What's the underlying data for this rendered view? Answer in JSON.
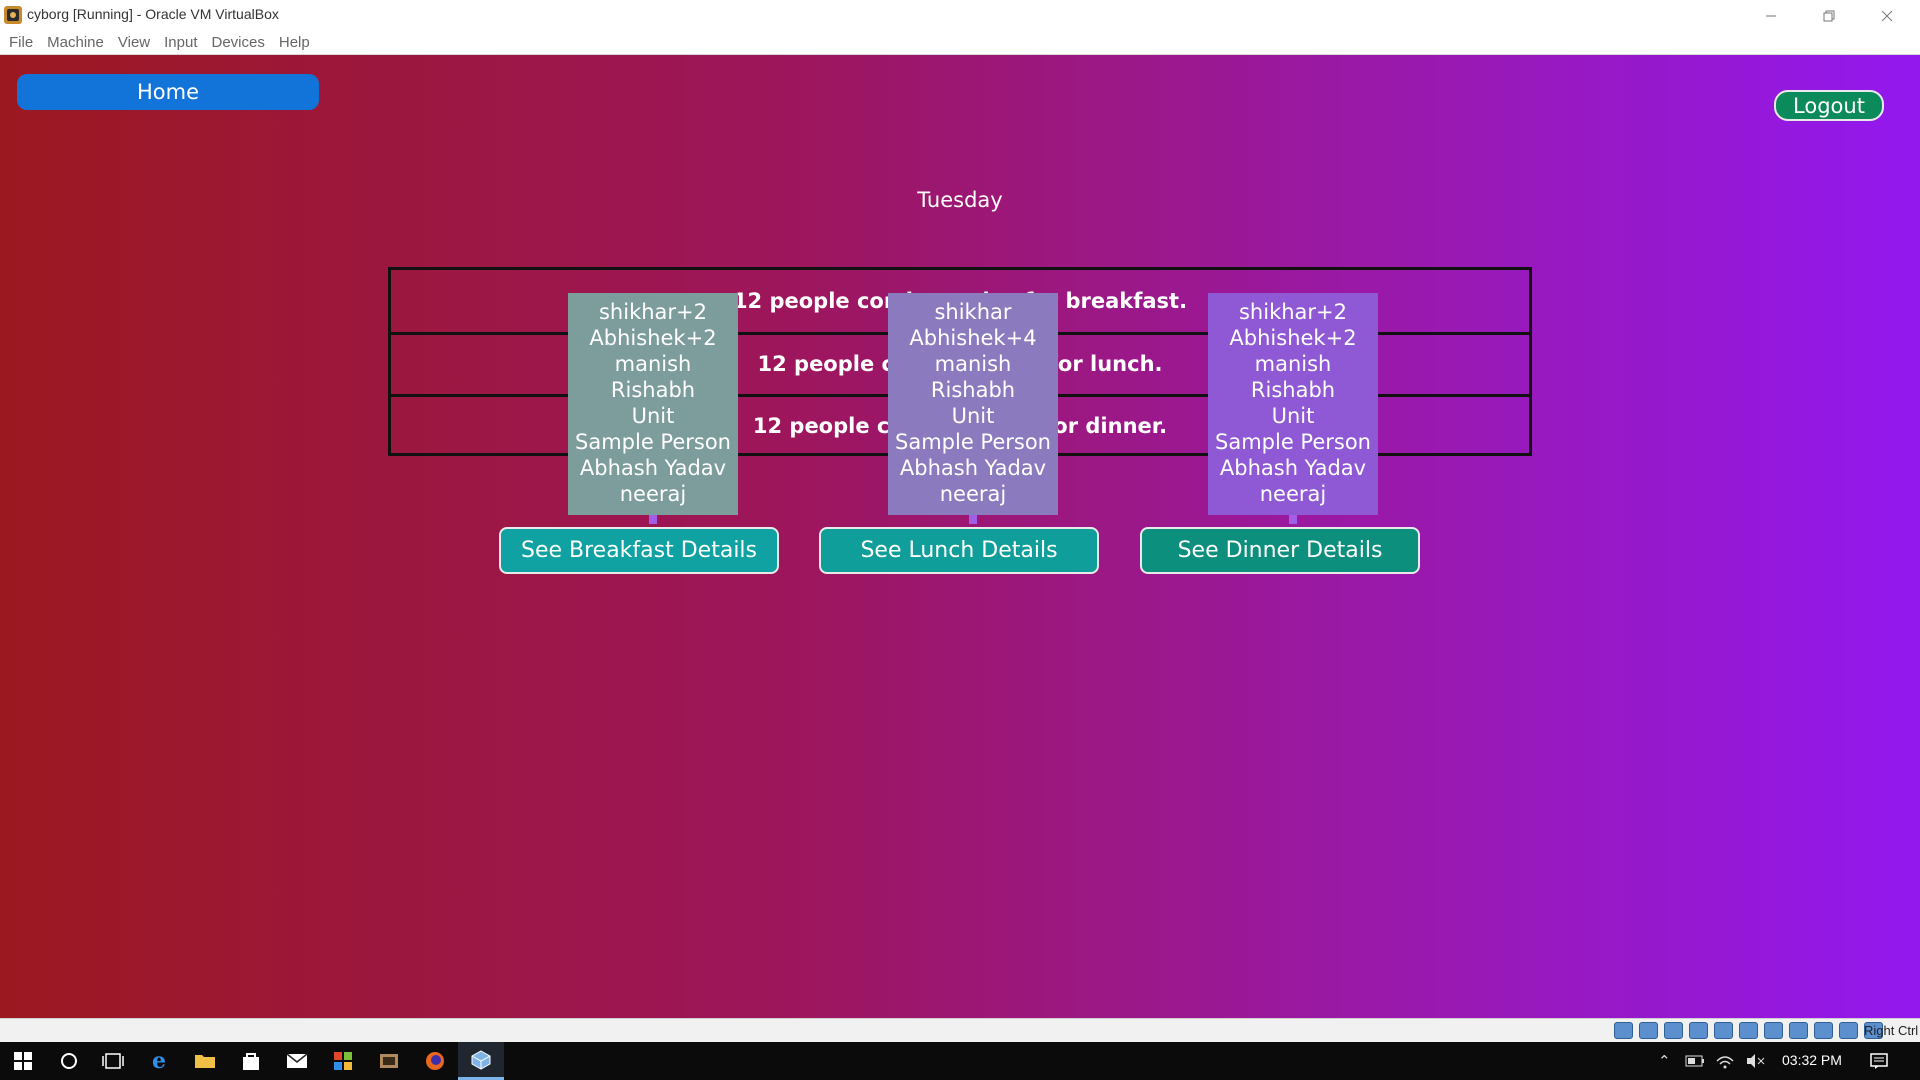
{
  "window": {
    "title": "cyborg [Running] - Oracle VM VirtualBox",
    "menu": [
      "File",
      "Machine",
      "View",
      "Input",
      "Devices",
      "Help"
    ]
  },
  "app": {
    "home_label": "Home",
    "logout_label": "Logout",
    "day": "Tuesday",
    "summary_rows": [
      "12 people coming today for breakfast.",
      "12 people coming today for lunch.",
      "12 people coming today for dinner."
    ],
    "meals": [
      {
        "names": [
          "shikhar+2",
          "Abhishek+2",
          "manish",
          "Rishabh",
          "Unit",
          "Sample Person",
          "Abhash Yadav",
          "neeraj"
        ],
        "button_label": "See Breakfast Details"
      },
      {
        "names": [
          "shikhar",
          "Abhishek+4",
          "manish",
          "Rishabh",
          "Unit",
          "Sample Person",
          "Abhash Yadav",
          "neeraj"
        ],
        "button_label": "See Lunch Details"
      },
      {
        "names": [
          "shikhar+2",
          "Abhishek+2",
          "manish",
          "Rishabh",
          "Unit",
          "Sample Person",
          "Abhash Yadav",
          "neeraj"
        ],
        "button_label": "See Dinner Details"
      }
    ]
  },
  "vbox_status": {
    "host_key": "Right Ctrl"
  },
  "taskbar": {
    "time": "03:32 PM"
  },
  "colors": {
    "home_button": "#1273d8",
    "logout_button": "#0b8a5c",
    "detail_button": "#10a2a2",
    "gradient_start": "#9c1820",
    "gradient_end": "#9318ef"
  }
}
